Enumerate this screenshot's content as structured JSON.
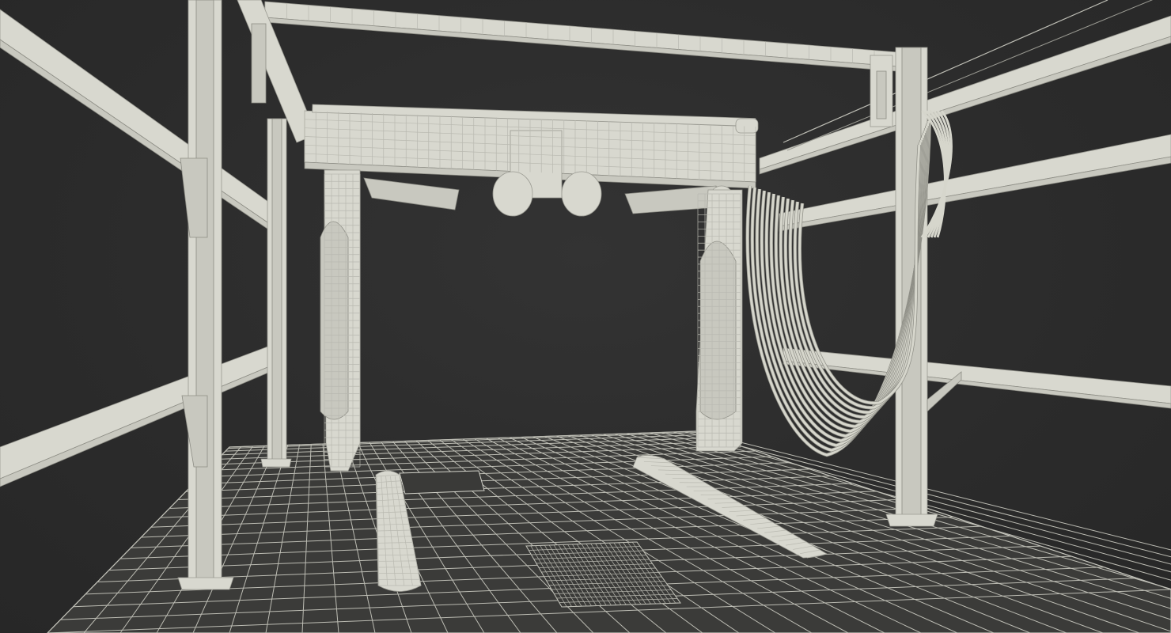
{
  "scene": {
    "colors": {
      "background": "#2e2e2e",
      "model": "#d8d8cf",
      "wire": "#9a9a92"
    }
  }
}
